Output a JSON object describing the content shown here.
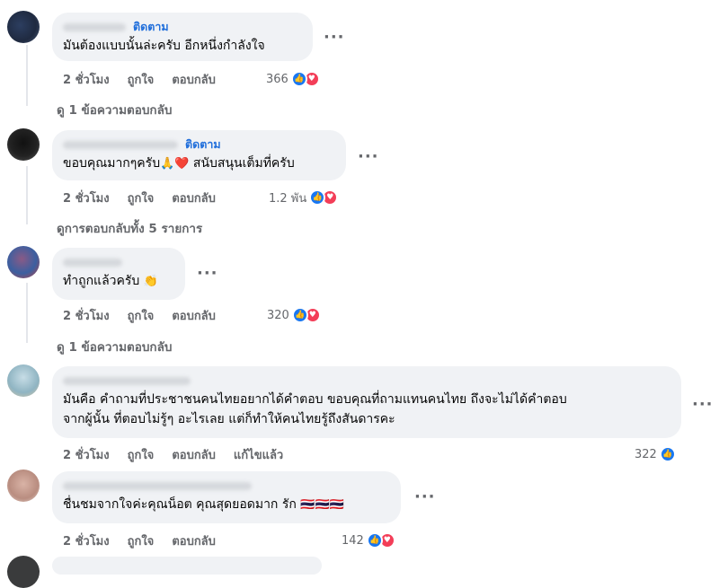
{
  "comments": [
    {
      "follow_label": "ติดตาม",
      "text": "มันต้องแบบนั้นล่ะครับ อีกหนึ่งกำลังใจ",
      "time": "2 ชั่วโมง",
      "like_label": "ถูกใจ",
      "reply_label": "ตอบกลับ",
      "reaction_count": "366",
      "view_replies": "ดู 1 ข้อความตอบกลับ"
    },
    {
      "follow_label": "ติดตาม",
      "text_part1": "ขอบคุณมากๆครับ",
      "emoji_1": "🙏",
      "emoji_2": "❤️",
      "text_part2": "สนับสนุนเต็มที่ครับ",
      "time": "2 ชั่วโมง",
      "like_label": "ถูกใจ",
      "reply_label": "ตอบกลับ",
      "reaction_count": "1.2 พัน",
      "view_replies": "ดูการตอบกลับทั้ง 5 รายการ"
    },
    {
      "text": "ทำถูกแล้วครับ",
      "emoji": "👏",
      "time": "2 ชั่วโมง",
      "like_label": "ถูกใจ",
      "reply_label": "ตอบกลับ",
      "reaction_count": "320",
      "view_replies": "ดู 1 ข้อความตอบกลับ"
    },
    {
      "line1": "มันคือ คำถามที่ประชาชนคนไทยอยากได้คำตอบ ขอบคุณที่ถามแทนคนไทย ถึงจะไม่ได้คำตอบ",
      "line2": "จากผู้นั้น ที่ตอบไม่รู้ๆ อะไรเลย แต่ก็ทำให้คนไทยรู้ถึงสันดารคะ",
      "time": "2 ชั่วโมง",
      "like_label": "ถูกใจ",
      "reply_label": "ตอบกลับ",
      "edited_label": "แก้ไขแล้ว",
      "reaction_count": "322"
    },
    {
      "text": "ชื่นชมจากใจค่ะคุณน็อต คุณสุดยอดมาก รัก",
      "flags": "🇹🇭🇹🇭🇹🇭",
      "time": "2 ชั่วโมง",
      "like_label": "ถูกใจ",
      "reply_label": "ตอบกลับ",
      "reaction_count": "142"
    }
  ],
  "more_glyph": "···",
  "icons": {
    "like": "thumbs-up-icon",
    "love": "heart-icon"
  },
  "colors": {
    "bubble": "#f0f2f5",
    "follow": "#216fdb",
    "like": "#1877f2",
    "love": "#f33e58",
    "meta": "#65676b"
  }
}
